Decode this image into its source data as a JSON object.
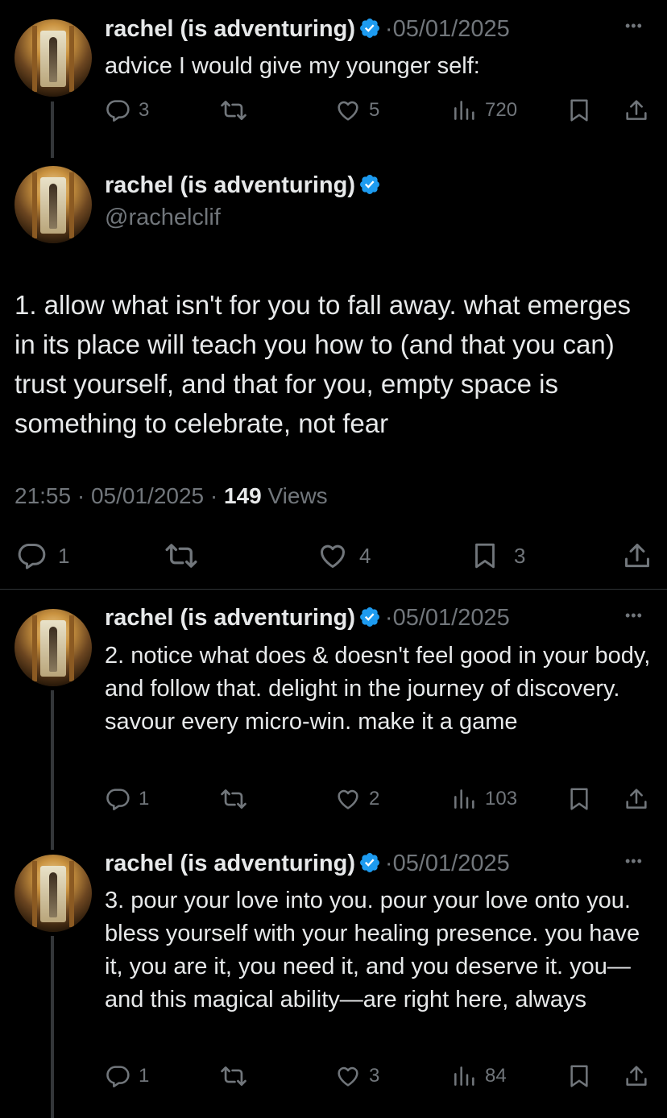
{
  "thread": [
    {
      "name": "rachel (is adventuring)",
      "date": "05/01/2025",
      "sep": "·",
      "text": "advice I would give my younger self:",
      "replies": "3",
      "likes": "5",
      "views": "720"
    },
    {
      "name": "rachel (is adventuring)",
      "date": "05/01/2025",
      "sep": "·",
      "text": "2. notice what does & doesn't feel good in your body, and follow that. delight in the journey of discovery. savour every micro-win. make it a game",
      "replies": "1",
      "likes": "2",
      "views": "103"
    },
    {
      "name": "rachel (is adventuring)",
      "date": "05/01/2025",
      "sep": "·",
      "text": "3. pour your love into you. pour your love onto you. bless yourself with your healing presence. you have it, you are it, you need it, and you deserve it. you—and this magical ability—are right here, always",
      "replies": "1",
      "likes": "3",
      "views": "84"
    }
  ],
  "main": {
    "name": "rachel (is adventuring)",
    "handle": "@rachelclif",
    "text": "1. allow what isn't for you to fall away. what emerges in its place will teach you how to (and that you can) trust yourself, and that for you, empty space is something to celebrate, not fear",
    "time": "21:55",
    "date": "05/01/2025",
    "sep": "·",
    "views_count": "149",
    "views_label": "Views",
    "replies": "1",
    "likes": "4",
    "bookmarks": "3"
  },
  "more_glyph": "•••",
  "colors": {
    "verified": "#1d9bf0",
    "muted": "#71767b",
    "text": "#e7e9ea",
    "background": "#000000"
  },
  "icons": [
    "verified-badge-icon",
    "reply-icon",
    "retweet-icon",
    "like-icon",
    "views-icon",
    "bookmark-icon",
    "share-icon",
    "more-icon"
  ]
}
